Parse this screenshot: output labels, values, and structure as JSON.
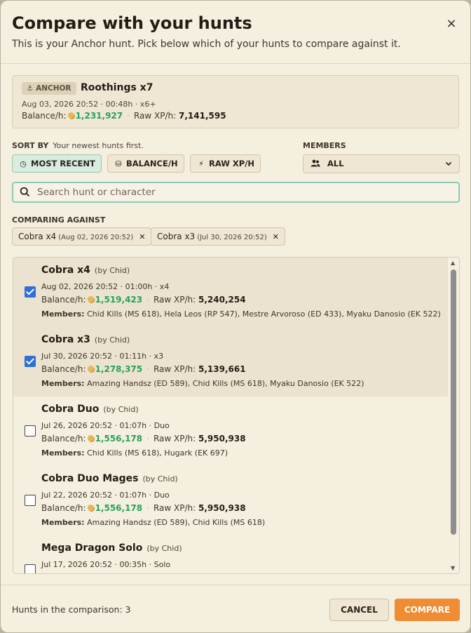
{
  "header": {
    "title": "Compare with your hunts",
    "subtitle": "This is your Anchor hunt. Pick below which of your hunts to compare against it.",
    "close_icon": "×"
  },
  "anchor": {
    "badge_icon": "⚓",
    "badge_label": "ANCHOR",
    "name": "Roothings x7",
    "meta": "Aug 03, 2026 20:52 · 00:48h · x6+",
    "balance_label": "Balance/h:",
    "balance_value": "1,231,927",
    "xp_label": "Raw XP/h:",
    "xp_value": "7,141,595"
  },
  "sort": {
    "label": "SORT BY",
    "hint": "Your newest hunts first.",
    "options": [
      {
        "icon": "clock-icon",
        "glyph": "◷",
        "label": "MOST RECENT",
        "active": true
      },
      {
        "icon": "coins-icon",
        "glyph": "⛁",
        "label": "BALANCE/H",
        "active": false
      },
      {
        "icon": "bolt-icon",
        "glyph": "⚡",
        "label": "RAW XP/H",
        "active": false
      }
    ]
  },
  "members": {
    "label": "MEMBERS",
    "selected": "ALL",
    "icon": "users-icon"
  },
  "search": {
    "placeholder": "Search hunt or character",
    "value": ""
  },
  "comparing": {
    "label": "COMPARING AGAINST",
    "chips": [
      {
        "name": "Cobra x4",
        "date": "(Aug 02, 2026 20:52)"
      },
      {
        "name": "Cobra x3",
        "date": "(Jul 30, 2026 20:52)"
      }
    ]
  },
  "list_labels": {
    "balance_label": "Balance/h:",
    "xp_label": "Raw XP/h:",
    "members_label": "Members:"
  },
  "hunts": [
    {
      "name": "Cobra x4",
      "by": "(by Chid)",
      "checked": true,
      "meta": "Aug 02, 2026 20:52 · 01:00h · x4",
      "balance": "1,519,423",
      "xp": "5,240,254",
      "members": "Chid Kills (MS 618), Hela Leos (RP 547), Mestre Arvoroso (ED 433), Myaku Danosio (EK 522)"
    },
    {
      "name": "Cobra x3",
      "by": "(by Chid)",
      "checked": true,
      "meta": "Jul 30, 2026 20:52 · 01:11h · x3",
      "balance": "1,278,375",
      "xp": "5,139,661",
      "members": "Amazing Handsz (ED 589), Chid Kills (MS 618), Myaku Danosio (EK 522)"
    },
    {
      "name": "Cobra Duo",
      "by": "(by Chid)",
      "checked": false,
      "meta": "Jul 26, 2026 20:52 · 01:07h · Duo",
      "balance": "1,556,178",
      "xp": "5,950,938",
      "members": "Chid Kills (MS 618), Hugark (EK 697)"
    },
    {
      "name": "Cobra Duo Mages",
      "by": "(by Chid)",
      "checked": false,
      "meta": "Jul 22, 2026 20:52 · 01:07h · Duo",
      "balance": "1,556,178",
      "xp": "5,950,938",
      "members": "Amazing Handsz (ED 589), Chid Kills (MS 618)"
    },
    {
      "name": "Mega Dragon Solo",
      "by": "(by Chid)",
      "checked": false,
      "meta": "Jul 17, 2026 20:52 · 00:35h · Solo",
      "balance": "",
      "xp": "",
      "members": ""
    }
  ],
  "footer": {
    "summary": "Hunts in the comparison: 3",
    "cancel_label": "CANCEL",
    "compare_label": "COMPARE"
  },
  "colors": {
    "accent": "#ef8c34",
    "balance_green": "#26a35a",
    "checkbox_blue": "#2f6fd8"
  }
}
